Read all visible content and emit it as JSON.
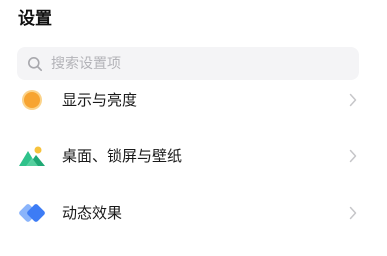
{
  "header": {
    "title": "设置"
  },
  "search": {
    "placeholder": "搜索设置项",
    "value": "",
    "icon": "search-icon"
  },
  "settings_list": {
    "items": [
      {
        "label": "显示与亮度",
        "icon": "sun-icon",
        "color": "#f7a431"
      },
      {
        "label": "桌面、锁屏与壁纸",
        "icon": "wallpaper-icon",
        "color": "#2fc28b"
      },
      {
        "label": "动态效果",
        "icon": "motion-effect-icon",
        "color": "#3d7cf5"
      }
    ]
  },
  "colors": {
    "chevron": "#c6c6c9",
    "search_bg": "#f4f4f6"
  }
}
